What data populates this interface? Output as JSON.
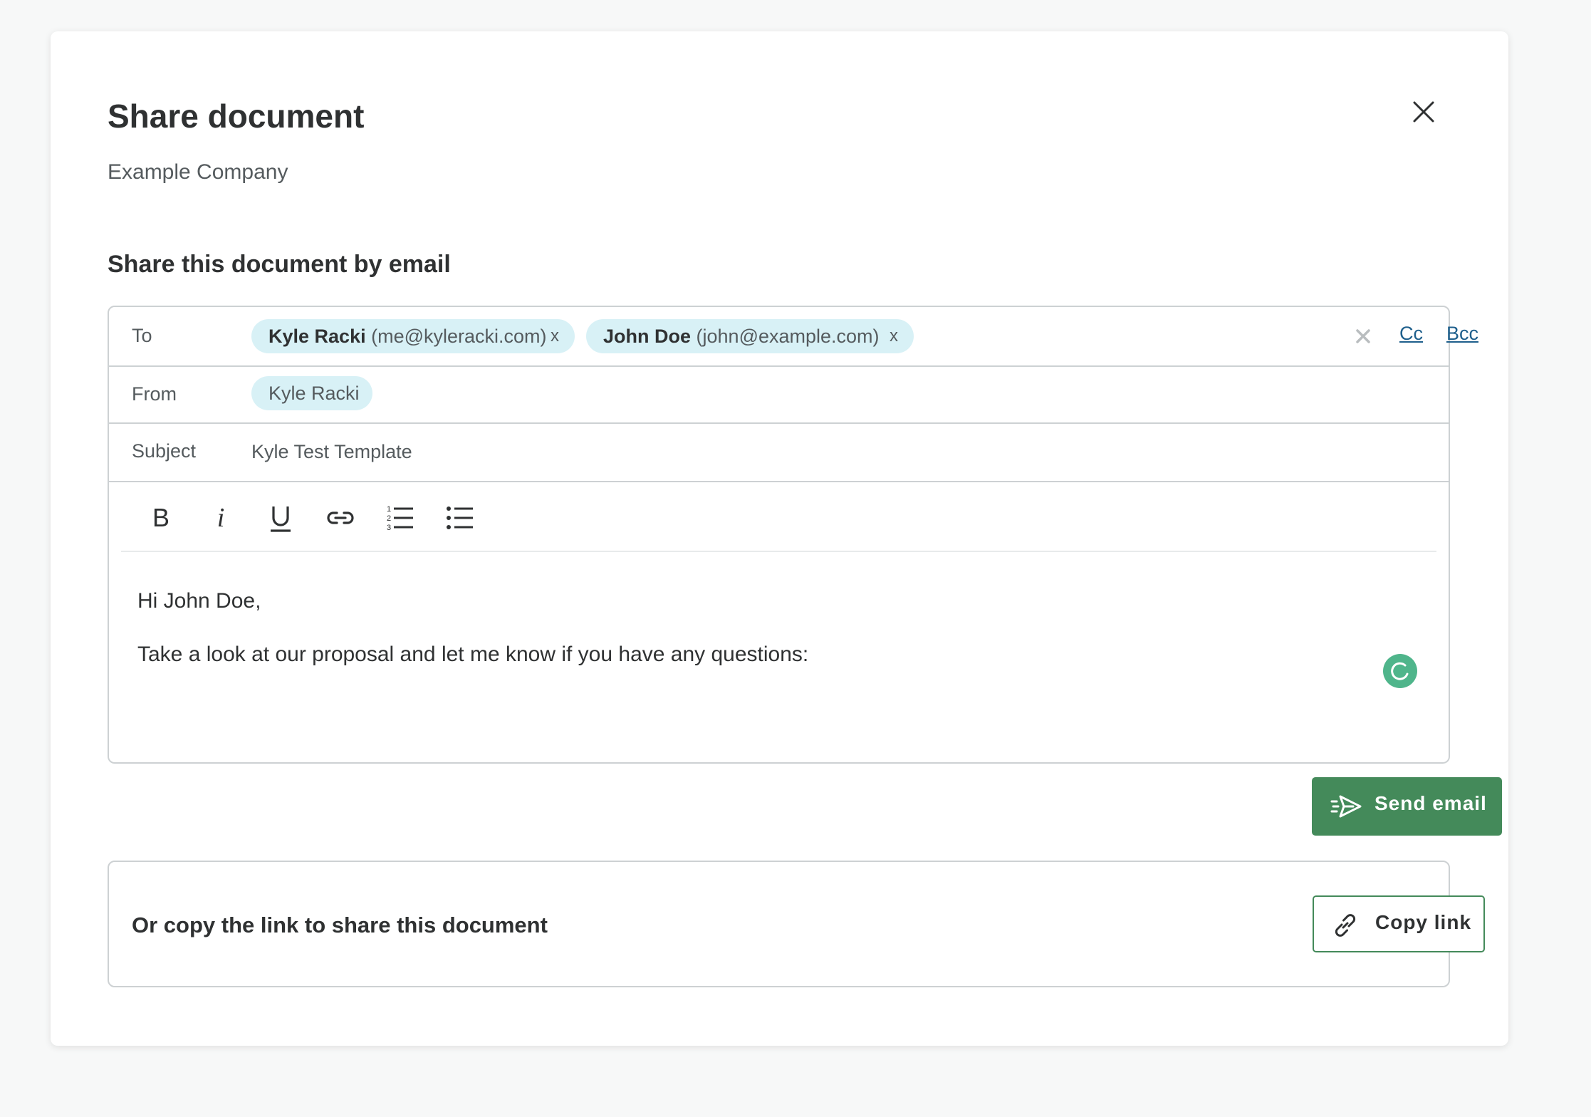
{
  "modal": {
    "title": "Share document",
    "subtitle": "Example Company",
    "close_icon": "close-icon"
  },
  "email_section": {
    "heading": "Share this document by email",
    "to": {
      "label": "To",
      "recipients": [
        {
          "name": "Kyle Racki",
          "email": "(me@kyleracki.com)",
          "remove": "x"
        },
        {
          "name": "John Doe",
          "email": "(john@example.com)",
          "remove": "x"
        }
      ],
      "cc_label": "Cc",
      "bcc_label": "Bcc"
    },
    "from": {
      "label": "From",
      "sender": "Kyle Racki"
    },
    "subject": {
      "label": "Subject",
      "value": "Kyle Test Template"
    },
    "toolbar": [
      "bold-icon",
      "italic-icon",
      "underline-icon",
      "link-icon",
      "numbered-list-icon",
      "bulleted-list-icon"
    ],
    "body": {
      "line1": "Hi John Doe,",
      "line2": "Take a look at our proposal and let me know if you have any questions:"
    },
    "send_button": "Send email"
  },
  "copy_section": {
    "text": "Or copy the link to share this document",
    "button": "Copy link"
  },
  "colors": {
    "primary_green": "#448a5a",
    "chip_background": "#d8f1f6",
    "link_blue": "#1e5f8c",
    "spinner_green": "#4fb58b"
  }
}
